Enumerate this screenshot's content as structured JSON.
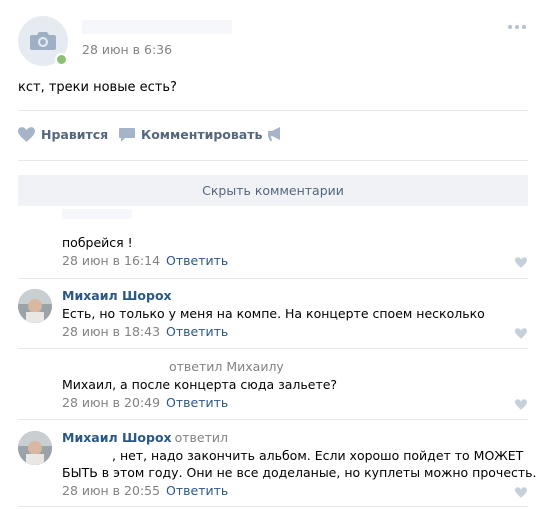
{
  "post": {
    "time": "28 июн в 6:36",
    "text": "кст, треки новые есть?",
    "actions": {
      "like": "Нравится",
      "comment": "Комментировать"
    }
  },
  "hide_comments_label": "Скрыть комментарии",
  "comments": [
    {
      "text": "побрейся !",
      "time": "28 июн в 16:14",
      "reply": "Ответить"
    },
    {
      "author": "Михаил Шорох",
      "text": "Есть, но только у меня на компе. На концерте споем несколько",
      "time": "28 июн в 18:43",
      "reply": "Ответить"
    },
    {
      "replied_to": "ответил Михаилу",
      "text": "Михаил, а после концерта сюда зальете?",
      "time": "28 июн в 20:49",
      "reply": "Ответить"
    },
    {
      "author": "Михаил Шорох",
      "replied_to": "ответил",
      "text_line1": ", нет, надо закончить альбом. Если хорошо пойдет то МОЖЕТ",
      "text_line2": "БЫТЬ в этом году. Они не все доделаные, но куплеты можно прочесть.",
      "time": "28 июн в 20:55",
      "reply": "Ответить"
    }
  ],
  "icons": {
    "camera": "camera-icon",
    "like": "heart-icon",
    "comment": "comment-icon",
    "share": "megaphone-icon",
    "more": "more-icon"
  },
  "colors": {
    "link": "#2a5885",
    "action": "#55677d",
    "muted": "#828282",
    "online": "#8ac176",
    "button_bg": "#f0f2f5"
  }
}
